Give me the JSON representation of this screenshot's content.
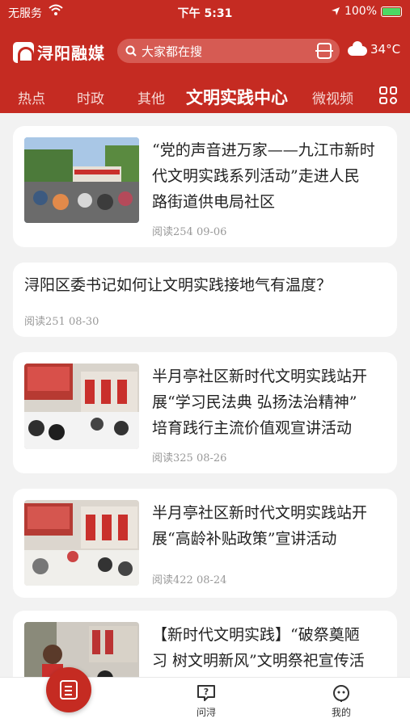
{
  "status_bar": {
    "carrier": "无服务",
    "time": "下午 5:31",
    "battery": "100%"
  },
  "header": {
    "app_name": "浔阳融媒",
    "search_placeholder": "大家都在搜",
    "weather": "34°C"
  },
  "tabs": [
    {
      "label": "热点"
    },
    {
      "label": "时政"
    },
    {
      "label": "其他"
    },
    {
      "label": "文明实践中心",
      "active": true
    },
    {
      "label": "微视频"
    }
  ],
  "articles": [
    {
      "title_lines": [
        "“党的声音进万家——九江市新时",
        "代文明实践系列活动”走进人民",
        "路街道供电局社区"
      ],
      "meta": "阅读254  09-06",
      "has_image": true
    },
    {
      "title_lines": [
        "浔阳区委书记如何让文明实践接地气有温度？"
      ],
      "meta": "阅读251  08-30",
      "has_image": false
    },
    {
      "title_lines": [
        "半月亭社区新时代文明实践站开",
        "展“学习民法典 弘扬法治精神”",
        "培育践行主流价值观宣讲活动"
      ],
      "meta": "阅读325  08-26",
      "has_image": true
    },
    {
      "title_lines": [
        "半月亭社区新时代文明实践站开",
        "展“高龄补贴政策”宣讲活动"
      ],
      "meta": "阅读422  08-24",
      "has_image": true
    },
    {
      "title_lines": [
        "【新时代文明实践】“破祭奠陋",
        "习 树文明新风”文明祭祀宣传活"
      ],
      "meta": "",
      "has_image": true
    }
  ],
  "bottom_nav": {
    "ask": "问浔",
    "mine": "我的"
  },
  "colors": {
    "brand_red": "#c52b22"
  }
}
